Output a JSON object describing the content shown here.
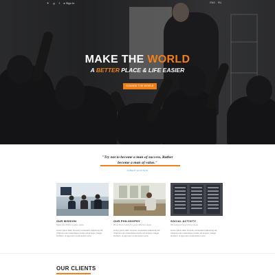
{
  "topbar": {
    "social": [
      {
        "icon": "twitter-icon",
        "glyph": "✦"
      },
      {
        "icon": "googleplus-icon",
        "glyph": "g"
      },
      {
        "icon": "facebook-icon",
        "glyph": "f"
      },
      {
        "icon": "login-icon",
        "glyph": "▸",
        "label": "Sign In"
      }
    ],
    "languages": [
      "ENG",
      "RU"
    ]
  },
  "hero": {
    "title_plain": "MAKE THE ",
    "title_accent": "WORLD",
    "subtitle_prefix": "A ",
    "subtitle_accent": "BETTER",
    "subtitle_rest": " PLACE & LIFE EASIER",
    "button_label": "CHANGE THE WORLD"
  },
  "quote": {
    "text": "\"Try not to become a man of success. Rather become a man of value.\"",
    "author": "ALBERT EINSTEIN"
  },
  "cards": [
    {
      "title": "OUR MISSION",
      "subtitle": "Make the World a better place",
      "body": "Lorem ipsum dolor sit amet, consectetur adipiscing elit. Vivamus nunc scelerisque id ante vel tempus. Integer tincidunt, ut eget sem ut elementum eros."
    },
    {
      "title": "OUR PHILOSOPHY",
      "subtitle": "Be to Do is Guide for good different ideas",
      "body": "Lorem ipsum dolor sit amet, consectetur adipiscing elit. Vivamus nunc scelerisque id ante vel tempus. Integer tincidunt, ut eget sem ut elementum eros."
    },
    {
      "title": "SOCIAL ACTIVITY",
      "subtitle": "We advance Everything Clean",
      "body": "Lorem ipsum dolor sit amet, consectetur adipiscing elit. Vivamus nunc scelerisque id ante vel tempus. Integer tincidunt, ut eget sem ut elementum eros."
    }
  ],
  "clients": {
    "heading": "OUR CLIENTS"
  },
  "colors": {
    "accent": "#f0811a",
    "quote_author": "#5aa0c8"
  }
}
